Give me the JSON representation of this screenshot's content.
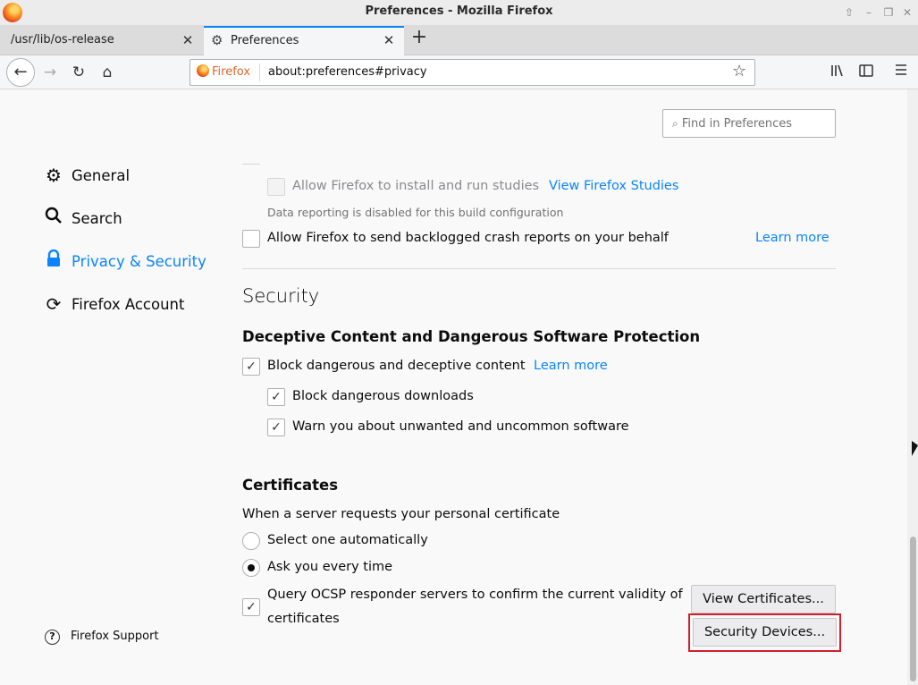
{
  "window": {
    "title": "Preferences - Mozilla Firefox",
    "controls": [
      "up-icon",
      "minimize-icon",
      "restore-icon",
      "close-icon"
    ]
  },
  "tabs": [
    {
      "label": "/usr/lib/os-release",
      "active": false
    },
    {
      "label": "Preferences",
      "active": true,
      "icon": "gear-icon"
    }
  ],
  "navbar": {
    "identity_label": "Firefox",
    "url": "about:preferences#privacy"
  },
  "sidebar": {
    "items": [
      {
        "label": "General",
        "icon": "gear-icon"
      },
      {
        "label": "Search",
        "icon": "search-icon"
      },
      {
        "label": "Privacy & Security",
        "icon": "lock-icon",
        "active": true
      },
      {
        "label": "Firefox Account",
        "icon": "sync-icon"
      }
    ],
    "support_label": "Firefox Support"
  },
  "find": {
    "placeholder": "Find in Preferences"
  },
  "data_collection": {
    "studies_label": "Allow Firefox to install and run studies",
    "studies_link": "View Firefox Studies",
    "disabled_note": "Data reporting is disabled for this build configuration",
    "crash_label": "Allow Firefox to send backlogged crash reports on your behalf",
    "crash_link": "Learn more"
  },
  "security": {
    "heading": "Security",
    "deceptive_heading": "Deceptive Content and Dangerous Software Protection",
    "block_deceptive_label": "Block dangerous and deceptive content",
    "block_deceptive_link": "Learn more",
    "block_downloads_label": "Block dangerous downloads",
    "warn_unwanted_label": "Warn you about unwanted and uncommon software"
  },
  "certificates": {
    "heading": "Certificates",
    "prompt": "When a server requests your personal certificate",
    "radio_auto": "Select one automatically",
    "radio_ask": "Ask you every time",
    "ocsp_line1": "Query OCSP responder servers to confirm the current validity of",
    "ocsp_line2": "certificates",
    "view_button": "View Certificates...",
    "devices_button": "Security Devices..."
  },
  "colors": {
    "accent": "#0a84ff",
    "focus_ring": "#d0202d"
  }
}
